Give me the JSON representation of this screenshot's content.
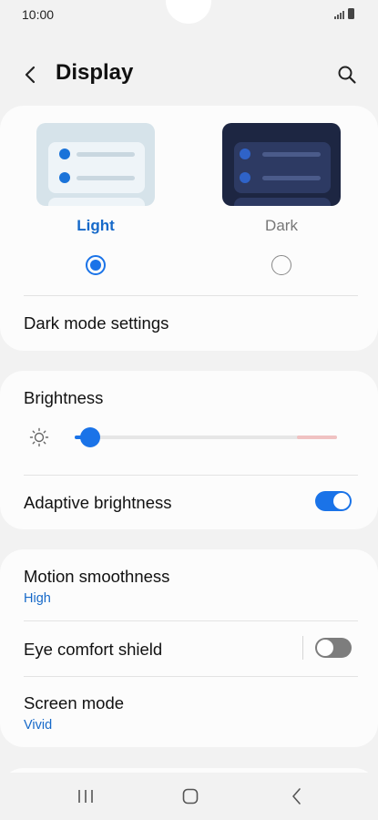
{
  "status_bar": {
    "time": "10:00",
    "icons": [
      "signal-icon",
      "battery-icon"
    ]
  },
  "header": {
    "title": "Display",
    "back_icon": "back-arrow-icon",
    "search_icon": "search-icon"
  },
  "theme": {
    "options": [
      {
        "label": "Light",
        "selected": true
      },
      {
        "label": "Dark",
        "selected": false
      }
    ],
    "dark_mode_settings_label": "Dark mode settings"
  },
  "brightness": {
    "label": "Brightness",
    "level": 0.06,
    "icon": "sun-icon",
    "adaptive_label": "Adaptive brightness",
    "adaptive_on": true
  },
  "motion": {
    "label": "Motion smoothness",
    "value": "High"
  },
  "eye_comfort": {
    "label": "Eye comfort shield",
    "on": false
  },
  "screen_mode": {
    "label": "Screen mode",
    "value": "Vivid"
  },
  "colors": {
    "accent": "#1a73e8",
    "accent_text": "#1669c9",
    "background": "#f2f2f2",
    "card": "#fcfcfc",
    "toggle_off": "#7d7d7d"
  },
  "navigation_bar": {
    "buttons": [
      "recents-icon",
      "home-icon",
      "back-icon"
    ]
  }
}
